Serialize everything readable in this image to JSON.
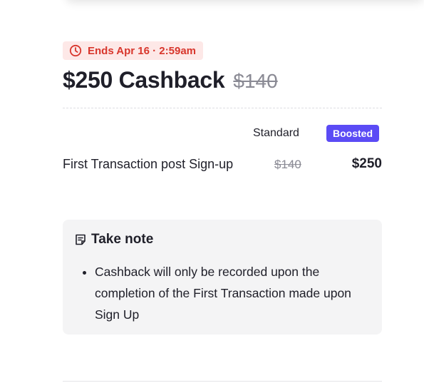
{
  "offer": {
    "ends_label": "Ends Apr 16 · 2:59am",
    "headline": "$250 Cashback",
    "old_amount": "$140"
  },
  "table": {
    "headers": {
      "standard": "Standard",
      "boosted": "Boosted"
    },
    "rows": [
      {
        "label": "First Transaction post Sign-up",
        "standard": "$140",
        "boosted": "$250"
      }
    ]
  },
  "note": {
    "title": "Take note",
    "items": [
      "Cashback will only be recorded upon the completion of the First Transaction made upon Sign Up"
    ]
  },
  "colors": {
    "accent": "#5b4bf5",
    "urgent_text": "#d8362c",
    "urgent_bg": "#fde8e7",
    "note_bg": "#f4f4f5",
    "muted": "#8a8a94"
  },
  "icons": {
    "ends": "clock-icon",
    "note": "note-icon"
  }
}
